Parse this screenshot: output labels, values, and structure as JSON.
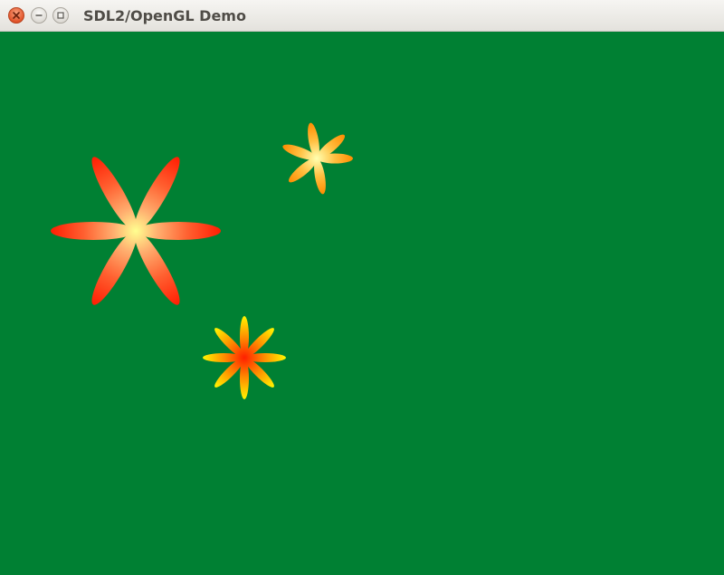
{
  "window": {
    "title": "SDL2/OpenGL Demo",
    "controls": {
      "close": "close-icon",
      "minimize": "minimize-icon",
      "maximize": "maximize-icon"
    }
  },
  "scene": {
    "background_color": "#008033",
    "flowers": [
      {
        "name": "large-red-flower",
        "petals": 6,
        "center_color": "#ffff80",
        "tip_color": "#ff2000"
      },
      {
        "name": "small-orange-flower",
        "petals": 6,
        "center_color": "#ffffa0",
        "tip_color": "#ff8c00"
      },
      {
        "name": "medium-yellow-red-flower",
        "petals": 8,
        "center_color": "#ff2000",
        "tip_color": "#ffff00"
      }
    ]
  }
}
